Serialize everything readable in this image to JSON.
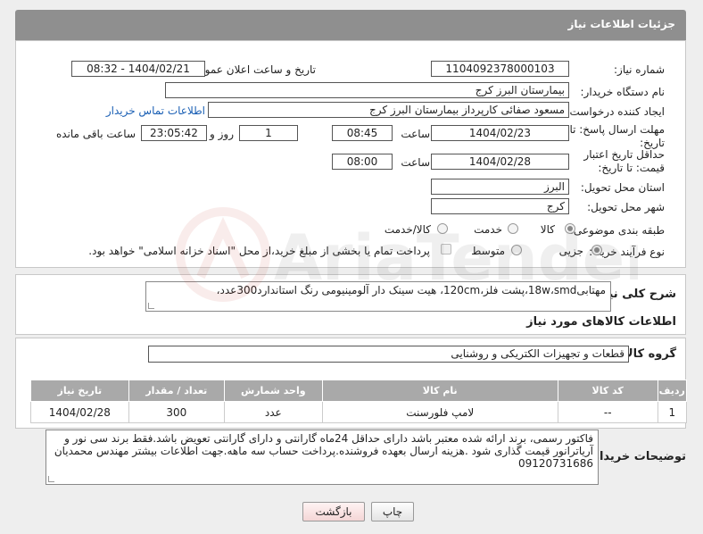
{
  "header": {
    "title": "جزئیات اطلاعات نیاز"
  },
  "form": {
    "need_number_label": "شماره نیاز:",
    "need_number": "1104092378000103",
    "announce_label": "تاریخ و ساعت اعلان عمومی:",
    "announce_value": "1404/02/21 - 08:32",
    "buyer_org_label": "نام دستگاه خریدار:",
    "buyer_org": "بیمارستان البرز کرج",
    "requester_label": "ایجاد کننده درخواست:",
    "requester": "مسعود صفائی کارپرداز بیمارستان البرز کرج",
    "contact_link": "اطلاعات تماس خریدار",
    "deadline_label": "مهلت ارسال پاسخ: تا تاریخ:",
    "deadline_date": "1404/02/23",
    "time_label": "ساعت",
    "deadline_time": "08:45",
    "days_value": "1",
    "days_label": "روز و",
    "remaining_value": "23:05:42",
    "remaining_label": "ساعت باقی مانده",
    "validity_label": "حداقل تاریخ اعتبار قیمت: تا تاریخ:",
    "validity_date": "1404/02/28",
    "validity_time": "08:00",
    "province_label": "استان محل تحویل:",
    "province": "البرز",
    "city_label": "شهر محل تحویل:",
    "city": "کرج",
    "category_label": "طبقه بندی موضوعی:",
    "category_options": [
      "کالا",
      "خدمت",
      "کالا/خدمت"
    ],
    "category_selected": "کالا",
    "process_label": "نوع فرآیند خرید :",
    "process_options": [
      "جزیی",
      "متوسط"
    ],
    "process_selected": "جزیی",
    "payment_note": "پرداخت تمام یا بخشی از مبلغ خرید،از محل \"اسناد خزانه اسلامی\" خواهد بود."
  },
  "summary": {
    "label": "شرح کلی نیاز:",
    "text": "مهتابی18w،smd،پشت فلز،120cm، هیت سینک دار آلومینیومی رنگ استاندارد300عدد،"
  },
  "goods_info": {
    "section_title": "اطلاعات کالاهای مورد نیاز",
    "group_label": "گروه کالا:",
    "group_value": "قطعات و تجهیزات الکتریکی و روشنایی",
    "columns": [
      "ردیف",
      "کد کالا",
      "نام کالا",
      "واحد شمارش",
      "تعداد / مقدار",
      "تاریخ نیاز"
    ],
    "rows": [
      {
        "row": "1",
        "code": "--",
        "name": "لامپ فلورسنت",
        "unit": "عدد",
        "qty": "300",
        "date": "1404/02/28"
      }
    ]
  },
  "buyer_notes": {
    "label": "توضیحات خریدار:",
    "text": "فاکتور رسمی، برند ارائه شده معتبر باشد دارای حداقل 24ماه گارانتی و دارای گارانتی تعویض باشد.فقط برند سی نور و آریاترانور قیمت گذاری شود .هزینه ارسال بعهده فروشنده.پرداخت حساب سه ماهه.جهت اطلاعات بیشتر مهندس محمدیان 09120731686"
  },
  "buttons": {
    "print": "چاپ",
    "back": "بازگشت"
  },
  "watermark_text": "AriaTender.neT"
}
